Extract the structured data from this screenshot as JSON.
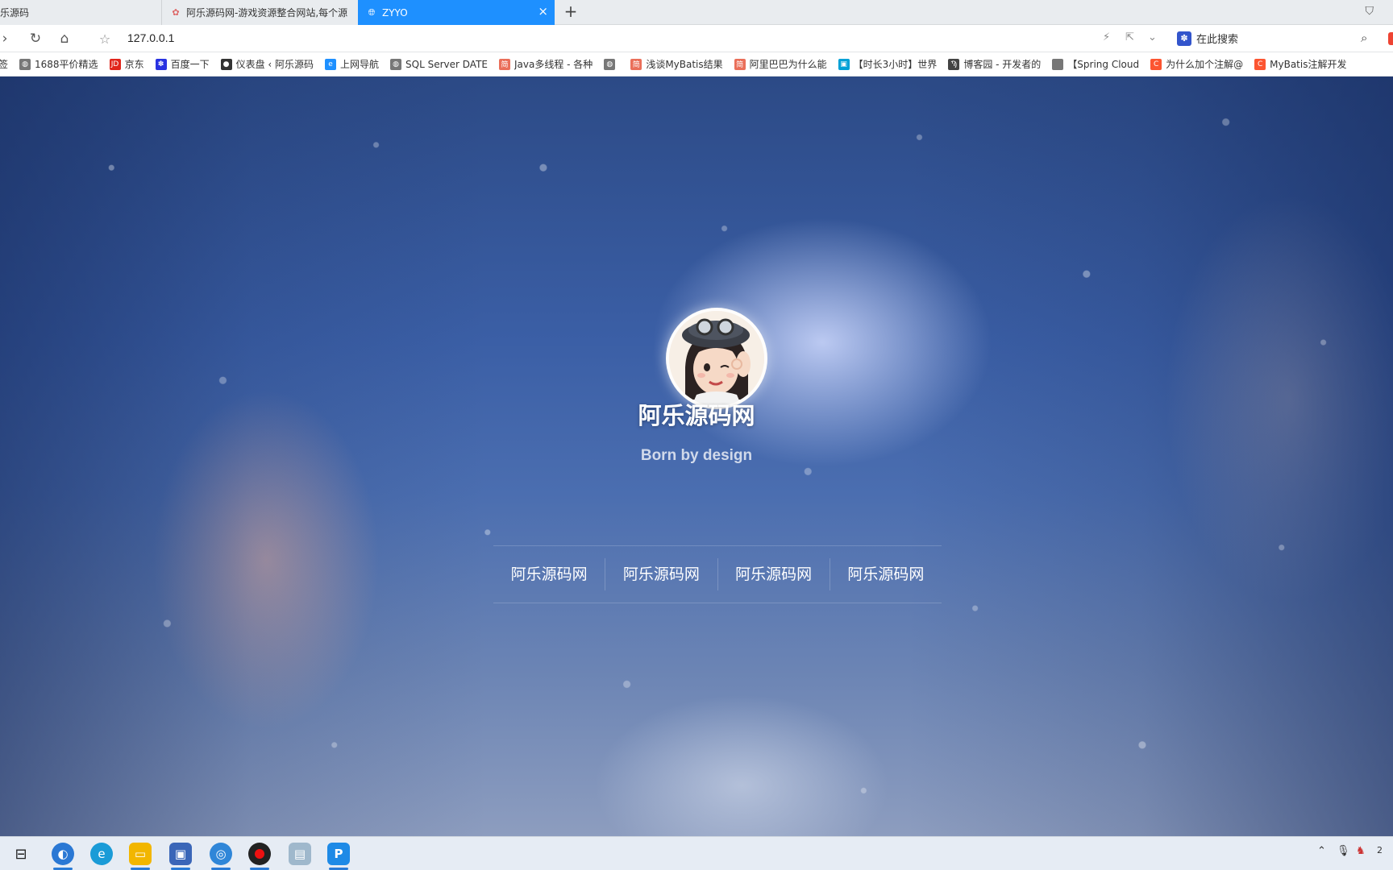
{
  "tabs": [
    {
      "title": "乐源码",
      "active": false
    },
    {
      "title": "阿乐源码网-游戏资源整合网站,每个源",
      "active": false
    },
    {
      "title": "ZYYO",
      "active": true
    }
  ],
  "new_tab_symbol": "+",
  "address_bar": {
    "url": "127.0.0.1",
    "search_placeholder": "在此搜索"
  },
  "bookmarks": [
    {
      "label": "签",
      "color": "#ffffff"
    },
    {
      "label": "1688平价精选",
      "color": "#777777"
    },
    {
      "label": "京东",
      "color": "#e1251b"
    },
    {
      "label": "百度一下",
      "color": "#2932e1"
    },
    {
      "label": "仪表盘 ‹ 阿乐源码",
      "color": "#333333"
    },
    {
      "label": "上网导航",
      "color": "#1e90ff"
    },
    {
      "label": "SQL Server DATE",
      "color": "#777777"
    },
    {
      "label": "Java多线程 - 各种",
      "color": "#ea6f5a"
    },
    {
      "label": "",
      "color": "#777777"
    },
    {
      "label": "浅谈MyBatis结果",
      "color": "#ea6f5a"
    },
    {
      "label": "阿里巴巴为什么能",
      "color": "#ea6f5a"
    },
    {
      "label": "【时长3小时】世界",
      "color": "#00a1d6"
    },
    {
      "label": "博客园 - 开发者的",
      "color": "#444444"
    },
    {
      "label": "【Spring Cloud",
      "color": "#777777"
    },
    {
      "label": "为什么加个注解@",
      "color": "#fc5531"
    },
    {
      "label": "MyBatis注解开发",
      "color": "#fc5531"
    }
  ],
  "hero": {
    "title": "阿乐源码网",
    "tagline": "Born by design",
    "links": [
      "阿乐源码网",
      "阿乐源码网",
      "阿乐源码网",
      "阿乐源码网"
    ]
  },
  "taskbar": {
    "apps": [
      {
        "name": "task-view-icon",
        "color": "transparent"
      },
      {
        "name": "browser-icon",
        "color": "#2a78d4"
      },
      {
        "name": "edge-icon",
        "color": "#1a9bd7"
      },
      {
        "name": "file-explorer-icon",
        "color": "#f2b600"
      },
      {
        "name": "network-app-icon",
        "color": "#3a66b8"
      },
      {
        "name": "browser-app-icon",
        "color": "#2f86d8"
      },
      {
        "name": "record-icon",
        "color": "#222222"
      },
      {
        "name": "notepad-icon",
        "color": "#9fb8cc"
      },
      {
        "name": "p-app-icon",
        "color": "#1e8ae6"
      }
    ],
    "clock": "2"
  }
}
